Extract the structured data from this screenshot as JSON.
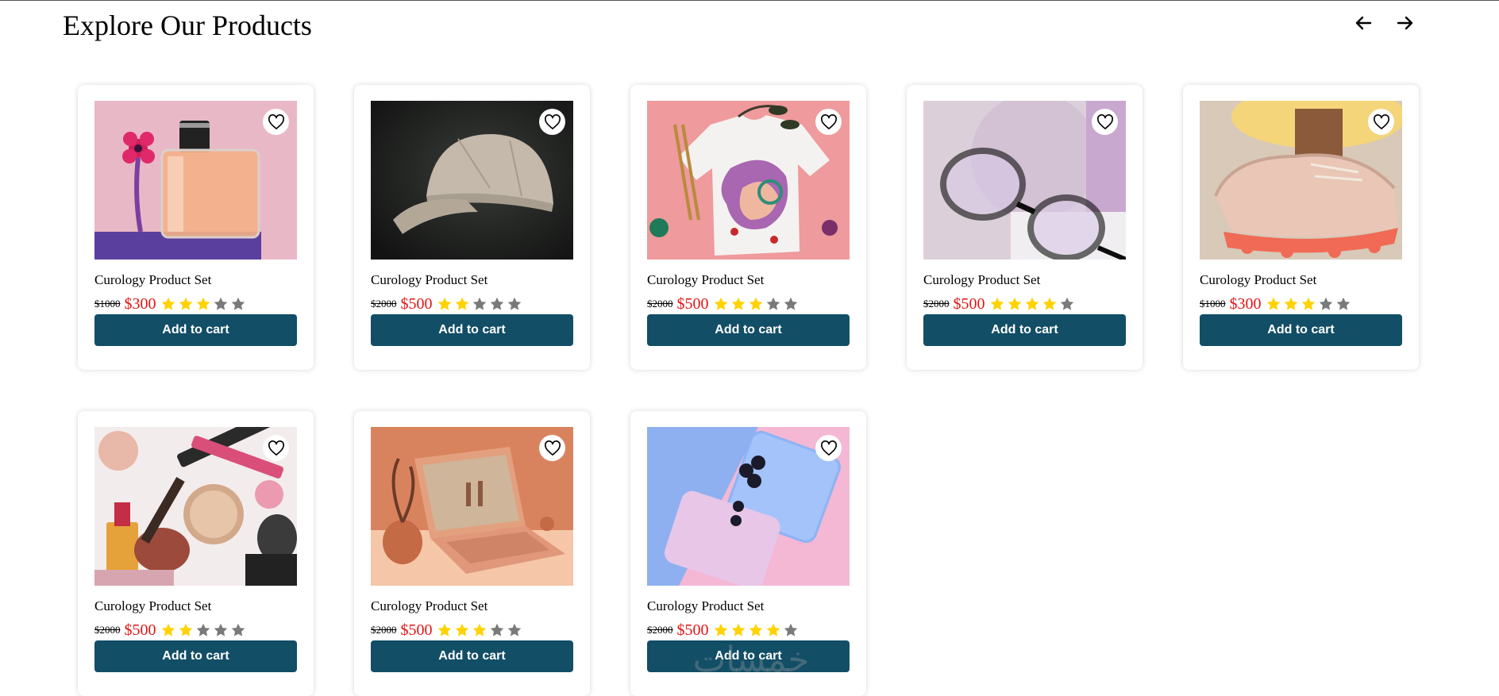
{
  "page": {
    "title": "Explore Our Products",
    "prev_icon": "arrow-left-icon",
    "next_icon": "arrow-right-icon"
  },
  "theme": {
    "button_color": "#124e66",
    "button_text_color": "#ffffff",
    "new_price_color": "#e41414",
    "star_filled_color": "#ffd200",
    "star_empty_color": "#7a7a7a"
  },
  "products": [
    {
      "name": "Curology Product Set",
      "old_price": "$1000",
      "price": "$300",
      "rating": 3,
      "max_rating": 5,
      "button_label": "Add to cart",
      "image": "perfume",
      "favorite_icon": "heart-outline-icon"
    },
    {
      "name": "Curology Product Set",
      "old_price": "$2000",
      "price": "$500",
      "rating": 2,
      "max_rating": 5,
      "button_label": "Add to cart",
      "image": "cap",
      "favorite_icon": "heart-outline-icon"
    },
    {
      "name": "Curology Product Set",
      "old_price": "$2000",
      "price": "$500",
      "rating": 3,
      "max_rating": 5,
      "button_label": "Add to cart",
      "image": "tshirt",
      "favorite_icon": "heart-outline-icon"
    },
    {
      "name": "Curology Product Set",
      "old_price": "$2000",
      "price": "$500",
      "rating": 4,
      "max_rating": 5,
      "button_label": "Add to cart",
      "image": "glasses",
      "favorite_icon": "heart-outline-icon"
    },
    {
      "name": "Curology Product Set",
      "old_price": "$1000",
      "price": "$300",
      "rating": 3,
      "max_rating": 5,
      "button_label": "Add to cart",
      "image": "sneaker",
      "favorite_icon": "heart-outline-icon"
    },
    {
      "name": "Curology Product Set",
      "old_price": "$2000",
      "price": "$500",
      "rating": 2,
      "max_rating": 5,
      "button_label": "Add to cart",
      "image": "makeup",
      "favorite_icon": "heart-outline-icon"
    },
    {
      "name": "Curology Product Set",
      "old_price": "$2000",
      "price": "$500",
      "rating": 3,
      "max_rating": 5,
      "button_label": "Add to cart",
      "image": "laptop",
      "favorite_icon": "heart-outline-icon"
    },
    {
      "name": "Curology Product Set",
      "old_price": "$2000",
      "price": "$500",
      "rating": 4,
      "max_rating": 5,
      "button_label": "Add to cart",
      "image": "phones",
      "favorite_icon": "heart-outline-icon"
    }
  ],
  "watermark": {
    "text": "خمسات"
  }
}
